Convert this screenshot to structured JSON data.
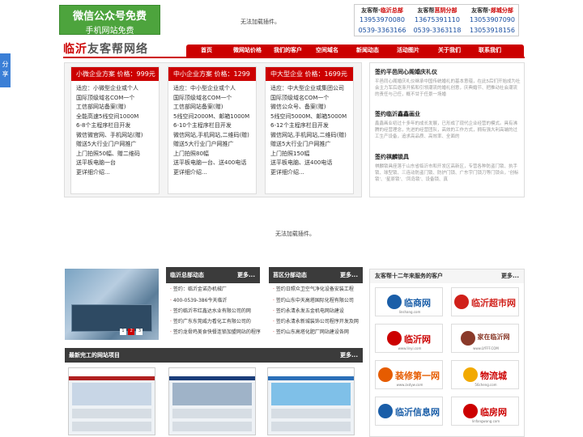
{
  "promo": {
    "line1": "微信公众号免费",
    "line2": "手机网站免费"
  },
  "plugin_msg_top": "无法加载插件。",
  "plugin_msg_mid": "无法加载插件。",
  "contact": [
    {
      "label_pre": "友客帮·",
      "label_red": "临沂总部",
      "phones": [
        "13953970080",
        "0539-3363166"
      ]
    },
    {
      "label_pre": "友客帮",
      "label_red": "莒阴分部",
      "phones": [
        "13675391110",
        "0539-3363118"
      ]
    },
    {
      "label_pre": "友客帮·",
      "label_red": "郯城分部",
      "phones": [
        "13053907090",
        "13053918156"
      ]
    }
  ],
  "share": {
    "label": "分享"
  },
  "logo": {
    "red": "临沂",
    "gray": "友客帮网络"
  },
  "nav": [
    "首页",
    "微网站价格",
    "我们的客户",
    "空间域名",
    "新闻动态",
    "活动图片",
    "关于我们",
    "联系我们"
  ],
  "plans": [
    {
      "title": "小微企业方案 价格：999元",
      "items": [
        "适应：小微型企业或个人",
        "国际顶级域名COM一个",
        "工信部网站备案(赠)",
        "全能高速5线空间1000M",
        "6-8个主程序栏目开发",
        "微信微官网、手机网站(赠)",
        "赠送5大行业门户网推广",
        "上门拍照50幅、赠二维码",
        "送平板电脑一台",
        "更详细介绍..."
      ]
    },
    {
      "title": "中小企业方案 价格：1299元",
      "items": [
        "适应：中小型企业或个人",
        "国际顶级域名COM一个",
        "工信部网站备案(赠)",
        "5线空间2000M、邮箱1000M",
        "6-10个主程序栏目开发",
        "微信网站,手机网站,二维码(赠)",
        "赠送5大行业门户网推广",
        "上门拍照80幅",
        "送平板电脑一台、送400电话",
        "更详细介绍..."
      ]
    },
    {
      "title": "中大型企业 价格：1699元",
      "items": [
        "适应：中大型企业或集团公司",
        "国际顶级域名COM一个",
        "微信公众号、备案(赠)",
        "5线空间5000M、邮箱5000M",
        "6-12个主程序栏目开发",
        "微信网站,手机网站,二维码(赠)",
        "赠送5大行业门户网推广",
        "上门拍照150幅",
        "送平板电脑、送400电话",
        "更详细介绍..."
      ]
    }
  ],
  "news": [
    {
      "title": "签约平邑同心阁婚庆礼仪",
      "desc": "平邑同心阁婚庆礼仪继承中国传统婚礼的基本意蕴，在此5后们开始成为社会主力军后逐渐开拓和引领潮流的婚礼创意，庆典婚节、把推动社会潮流的责任与己任，概不甘于任景一场婚"
    },
    {
      "title": "签约临沂鑫鑫画业",
      "desc": "鑫鑫画业初过十多年的成长发展，已形成了现代企业经营的模式。具有沸腾的经营理念，先进的经营团队，高效的工作方式，拥有强大利高端的过工生产设备，追求高品质、高效率、全面的"
    },
    {
      "title": "签约祺麟锁具",
      "desc": "祺麟锁具座落于山东省临沂市和开发区高新区，专营各种防盗门锁、执手锁、球型锁、三连动防盗门锁、防护门锁、广东宇门锁刀等门锁合，'创标锁'、'星原锁'、'凤岛锁'、设备锁、真"
    }
  ],
  "section_mid": {
    "title": "临沂总部动态",
    "more": "更多...",
    "items": [
      "签约：临沂金诺办机械厂",
      "400-0539-386今天临沂",
      "签约临沂市红鑫达水业有限公司的网",
      "签约广东东莞威力看化工有限公司的",
      "签约龙骨鸡美食快餐连锁加盟网站的程序"
    ]
  },
  "section_right": {
    "title": "莒区分部动态",
    "more": "更多...",
    "items": [
      "签约日照众卫空气净化设备安装工程",
      "签约山东中天高塔国际化程有限公司",
      "签约永清永发五金机电网站建设",
      "签约永清永新城装饰公司程序开发及网",
      "签约山东高塔化肥厂网站建设各网"
    ]
  },
  "clients": {
    "title": "友客帮十二年来服务的客户",
    "more": "更多...",
    "items": [
      {
        "name": "临商网",
        "sub": "linshang.com",
        "color": "#1a5ea8"
      },
      {
        "name": "临沂超市网",
        "sub": "",
        "color": "#d0201a"
      },
      {
        "name": "临沂网",
        "sub": "www.linyi.com",
        "color": "#c00"
      },
      {
        "name": "家在临沂网",
        "sub": "www.LYFFF.COM",
        "color": "#8a3a2a"
      },
      {
        "name": "装修第一网",
        "sub": "www.zxdyw.com",
        "color": "#e65c00"
      },
      {
        "name": "物流城",
        "sub": "56cheng.com",
        "color": "#c00"
      },
      {
        "name": "临沂信息网",
        "sub": "",
        "color": "#1a5ea8"
      },
      {
        "name": "临房网",
        "sub": "linfangwang.com",
        "color": "#c00"
      }
    ]
  },
  "projects": {
    "title": "最新完工的网站项目",
    "more": "更多..."
  },
  "slider_pages": [
    "1",
    "2",
    "3"
  ]
}
